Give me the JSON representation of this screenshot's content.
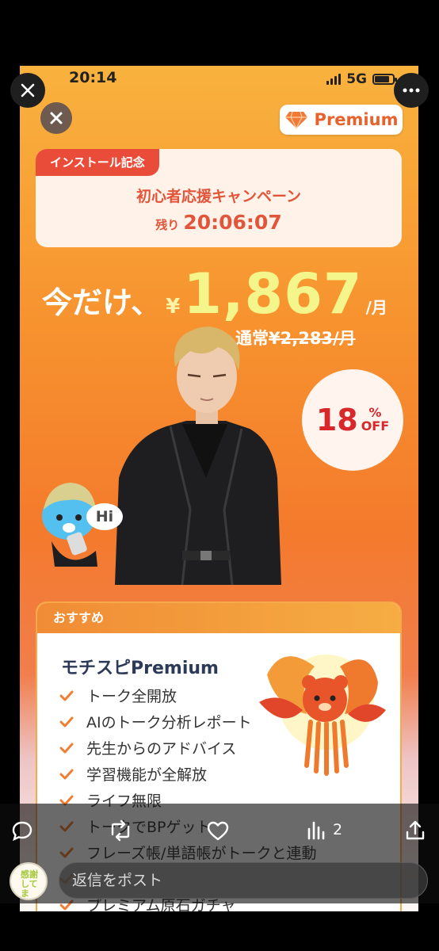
{
  "phone": {
    "status_bar": {
      "time": "20:14",
      "network": "5G"
    },
    "premium_button_label": "Premium",
    "campaign": {
      "tag": "インストール記念",
      "title": "初心者応援キャンペーン",
      "timer_prefix": "残り",
      "timer_value": "20:06:07"
    },
    "price": {
      "lead": "今だけ、",
      "currency": "¥",
      "value": "1,867",
      "unit": "/月",
      "regular_prefix": "通常",
      "regular_value": "¥2,283/月"
    },
    "discount": {
      "number": "18",
      "percent": "%",
      "off": "OFF"
    },
    "speech_bubble": "Hi",
    "recommend": {
      "header": "おすすめ",
      "plan_title": "モチスピPremium",
      "features": [
        "トーク全開放",
        "AIのトーク分析レポート",
        "先生からのアドバイス",
        "学習機能が全解放",
        "ライフ無限",
        "トークでBPゲット",
        "フレーズ帳/単語帳がトークと連動",
        "",
        "プレミアム原石ガチャ"
      ]
    },
    "colors": {
      "accent": "#e9622b",
      "tag_red": "#ea4c3a",
      "price_yellow": "#f4f58a",
      "discount_red": "#d8282c",
      "plan_navy": "#2d3a57"
    }
  },
  "viewer": {
    "views_count": "2",
    "reply_placeholder": "返信をポスト",
    "avatar_text": "感謝してま",
    "icons": [
      "close-icon",
      "more-icon",
      "reply-icon",
      "repost-icon",
      "like-icon",
      "views-icon",
      "share-icon"
    ]
  }
}
